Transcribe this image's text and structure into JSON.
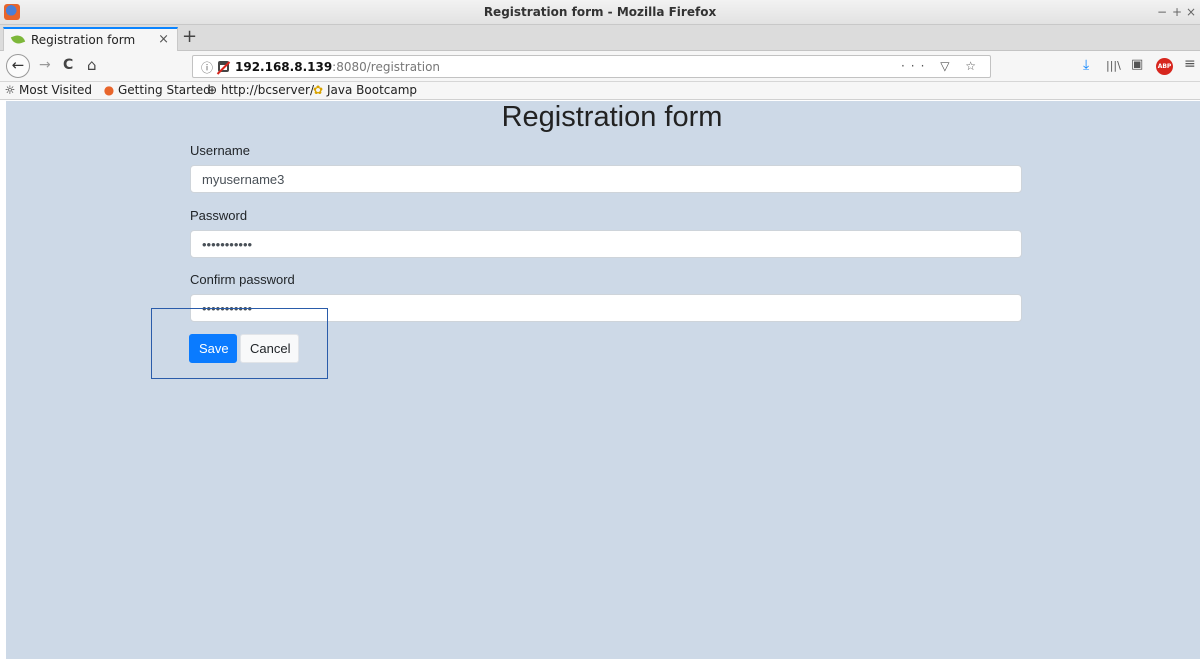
{
  "window": {
    "title": "Registration form - Mozilla Firefox",
    "controls": [
      "−",
      "+",
      "×"
    ]
  },
  "tabs": [
    {
      "label": "Registration form",
      "close": "×"
    }
  ],
  "new_tab": "+",
  "nav": {
    "back": "←",
    "forward": "→",
    "reload": "C",
    "home": "⌂"
  },
  "urlbar": {
    "info": "ⓘ",
    "host": "192.168.8.139",
    "rest": ":8080/registration",
    "page_actions": "··· ▽ ☆"
  },
  "toolbar": {
    "download": "⤓",
    "library": "|||\\",
    "sidebar": "▣",
    "abp": "ABP",
    "menu": "≡"
  },
  "bookmarks": [
    {
      "icon": "☼",
      "label": "Most Visited"
    },
    {
      "icon": "●",
      "label": "Getting Started"
    },
    {
      "icon": "⊕",
      "label": "http://bcserver/"
    },
    {
      "icon": "✿",
      "label": "Java Bootcamp"
    }
  ],
  "form": {
    "title": "Registration form",
    "username_label": "Username",
    "username_value": "myusername3",
    "password_label": "Password",
    "password_value": "•••••••••••",
    "confirm_label": "Confirm password",
    "confirm_value": "•••••••••••",
    "save_label": "Save",
    "cancel_label": "Cancel"
  },
  "colors": {
    "page_background": "#cdd9e7",
    "primary_button": "#0a7bff",
    "tab_accent": "#0a84ff"
  }
}
